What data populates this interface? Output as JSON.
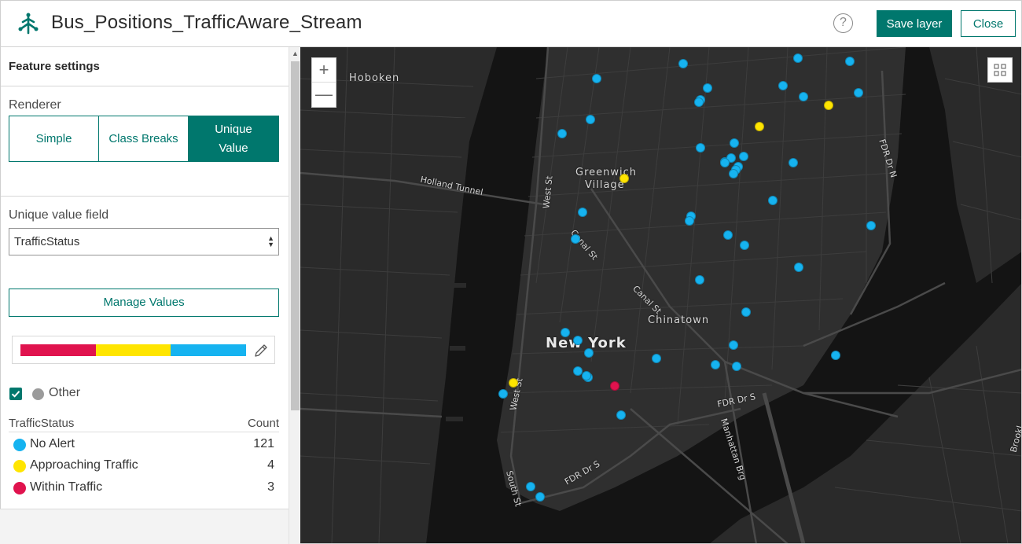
{
  "header": {
    "title": "Bus_Positions_TrafficAware_Stream",
    "help_icon": "?",
    "save_label": "Save layer",
    "close_label": "Close"
  },
  "panel": {
    "section_title": "Feature settings",
    "renderer_label": "Renderer",
    "renderer_options": [
      "Simple",
      "Class Breaks",
      "Unique Value"
    ],
    "renderer_selected": "Unique Value",
    "field_label": "Unique value field",
    "field_value": "TrafficStatus",
    "manage_label": "Manage Values",
    "ramp_colors": [
      "#e0134e",
      "#ffe500",
      "#16b3f0"
    ],
    "other_checked": true,
    "other_label": "Other",
    "other_color": "#9b9b9b",
    "table_header": {
      "field": "TrafficStatus",
      "count": "Count"
    },
    "values": [
      {
        "label": "No Alert",
        "count": "121",
        "color": "#16b3f0"
      },
      {
        "label": "Approaching Traffic",
        "count": "4",
        "color": "#ffe500"
      },
      {
        "label": "Within Traffic",
        "count": "3",
        "color": "#e0134e"
      }
    ]
  },
  "map": {
    "zoom_in": "+",
    "zoom_out": "—",
    "labels": {
      "hoboken": "Hoboken",
      "holland_tunnel": "Holland Tunnel",
      "greenwich": "Greenwich",
      "village": "Village",
      "west_st": "West St",
      "canal_st_1": "Canal St",
      "canal_st_2": "Canal St",
      "chinatown": "Chinatown",
      "new_york": "New York",
      "west_st_2": "West St",
      "south_st": "South St",
      "fdr_dr_s_1": "FDR Dr S",
      "fdr_dr_s_2": "FDR Dr S",
      "manhattan_brg": "Manhattan Brg",
      "fdr_dr_n": "FDR Dr N",
      "brooklyn": "Brookl"
    }
  }
}
